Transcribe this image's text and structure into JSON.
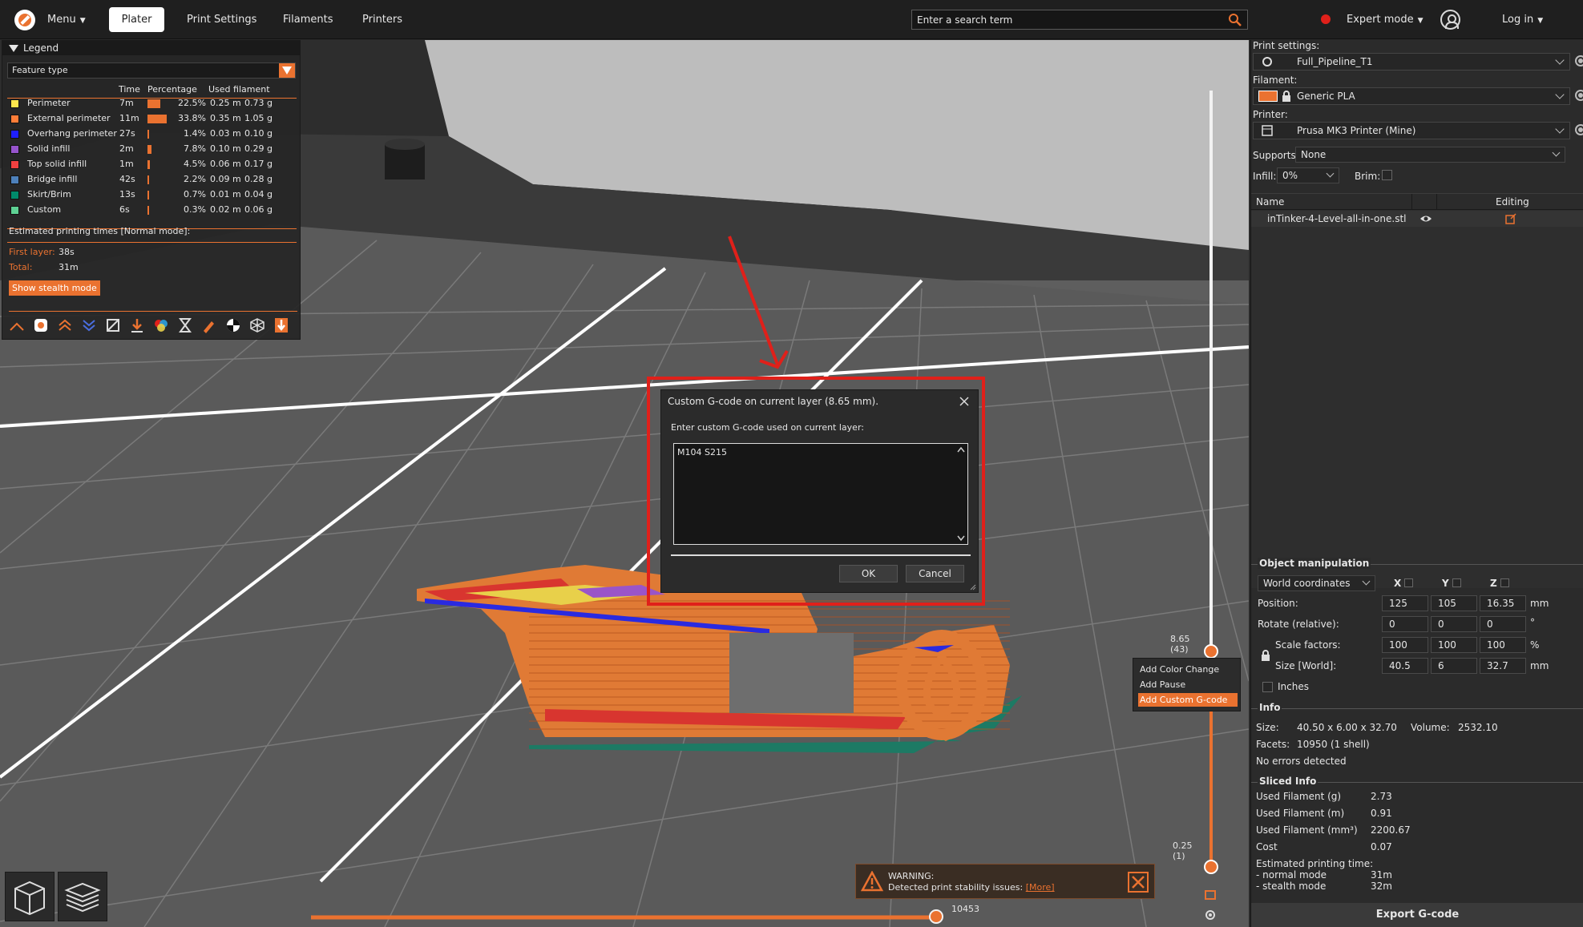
{
  "topbar": {
    "menu": "Menu",
    "tabs": [
      "Plater",
      "Print Settings",
      "Filaments",
      "Printers"
    ],
    "search_placeholder": "Enter a search term",
    "mode": "Expert mode",
    "login": "Log in"
  },
  "legend": {
    "title": "Legend",
    "feature_select": "Feature type",
    "col_time": "Time",
    "col_percentage": "Percentage",
    "col_used": "Used filament",
    "rows": [
      {
        "name": "Perimeter",
        "color": "#ffe64d",
        "time": "7m",
        "pct": "22.5%",
        "pct_value": 22.5,
        "m": "0.25 m",
        "g": "0.73 g"
      },
      {
        "name": "External perimeter",
        "color": "#ff7d38",
        "time": "11m",
        "pct": "33.8%",
        "pct_value": 33.8,
        "m": "0.35 m",
        "g": "1.05 g"
      },
      {
        "name": "Overhang perimeter",
        "color": "#1f1fff",
        "time": "27s",
        "pct": "1.4%",
        "pct_value": 1.4,
        "m": "0.03 m",
        "g": "0.10 g"
      },
      {
        "name": "Solid infill",
        "color": "#9654cc",
        "time": "2m",
        "pct": "7.8%",
        "pct_value": 7.8,
        "m": "0.10 m",
        "g": "0.29 g"
      },
      {
        "name": "Top solid infill",
        "color": "#f04040",
        "time": "1m",
        "pct": "4.5%",
        "pct_value": 4.5,
        "m": "0.06 m",
        "g": "0.17 g"
      },
      {
        "name": "Bridge infill",
        "color": "#4d80ba",
        "time": "42s",
        "pct": "2.2%",
        "pct_value": 2.2,
        "m": "0.09 m",
        "g": "0.28 g"
      },
      {
        "name": "Skirt/Brim",
        "color": "#008a6b",
        "time": "13s",
        "pct": "0.7%",
        "pct_value": 0.7,
        "m": "0.01 m",
        "g": "0.04 g"
      },
      {
        "name": "Custom",
        "color": "#5ed194",
        "time": "6s",
        "pct": "0.3%",
        "pct_value": 0.3,
        "m": "0.02 m",
        "g": "0.06 g"
      }
    ],
    "est_title": "Estimated printing times [Normal mode]:",
    "first_layer_label": "First layer:",
    "first_layer": "38s",
    "total_label": "Total:",
    "total": "31m",
    "stealth_button": "Show stealth mode"
  },
  "sidebar": {
    "print_settings_label": "Print settings:",
    "print_settings": "Full_Pipeline_T1",
    "filament_label": "Filament:",
    "filament": "Generic PLA",
    "filament_color": "#ea7230",
    "printer_label": "Printer:",
    "printer": "Prusa MK3 Printer (Mine)",
    "supports_label": "Supports:",
    "supports": "None",
    "infill_label": "Infill:",
    "infill": "0%",
    "brim_label": "Brim:",
    "list_col_name": "Name",
    "list_col_editing": "Editing",
    "object_name": "inTinker-4-Level-all-in-one.stl",
    "obj_manip_title": "Object manipulation",
    "coord_system": "World coordinates",
    "axis_x": "X",
    "axis_y": "Y",
    "axis_z": "Z",
    "position_label": "Position:",
    "position": [
      "125",
      "105",
      "16.35"
    ],
    "rotate_label": "Rotate (relative):",
    "rotate": [
      "0",
      "0",
      "0"
    ],
    "scale_label": "Scale factors:",
    "scale": [
      "100",
      "100",
      "100"
    ],
    "size_label": "Size [World]:",
    "size": [
      "40.5",
      "6",
      "32.7"
    ],
    "unit_mm": "mm",
    "unit_deg": "°",
    "unit_pct": "%",
    "inches_label": "Inches",
    "info_title": "Info",
    "info_size_label": "Size:",
    "info_size": "40.50 x 6.00 x 32.70",
    "info_volume_label": "Volume:",
    "info_volume": "2532.10",
    "info_facets_label": "Facets:",
    "info_facets": "10950 (1 shell)",
    "info_errors": "No errors detected",
    "sliced_title": "Sliced Info",
    "sliced_g_label": "Used Filament (g)",
    "sliced_g": "2.73",
    "sliced_m_label": "Used Filament (m)",
    "sliced_m": "0.91",
    "sliced_mm3_label": "Used Filament (mm³)",
    "sliced_mm3": "2200.67",
    "cost_label": "Cost",
    "cost": "0.07",
    "est_label": "Estimated printing time:",
    "normal_mode_label": "- normal mode",
    "normal_mode": "31m",
    "stealth_mode_label": "- stealth mode",
    "stealth_mode": "32m",
    "export_button": "Export G-code"
  },
  "slider": {
    "top_value": "8.65",
    "top_layer": "(43)",
    "bottom_value": "0.25",
    "bottom_layer": "(1)",
    "h_value": "10453"
  },
  "context_menu": {
    "items": [
      "Add Color Change",
      "Add Pause",
      "Add Custom G-code"
    ]
  },
  "dialog": {
    "title": "Custom G-code on current layer (8.65 mm).",
    "prompt": "Enter custom G-code used on current layer:",
    "value": "M104 S215",
    "ok": "OK",
    "cancel": "Cancel"
  },
  "warning": {
    "title": "WARNING:",
    "message": "Detected print stability issues:",
    "more": "[More]"
  }
}
